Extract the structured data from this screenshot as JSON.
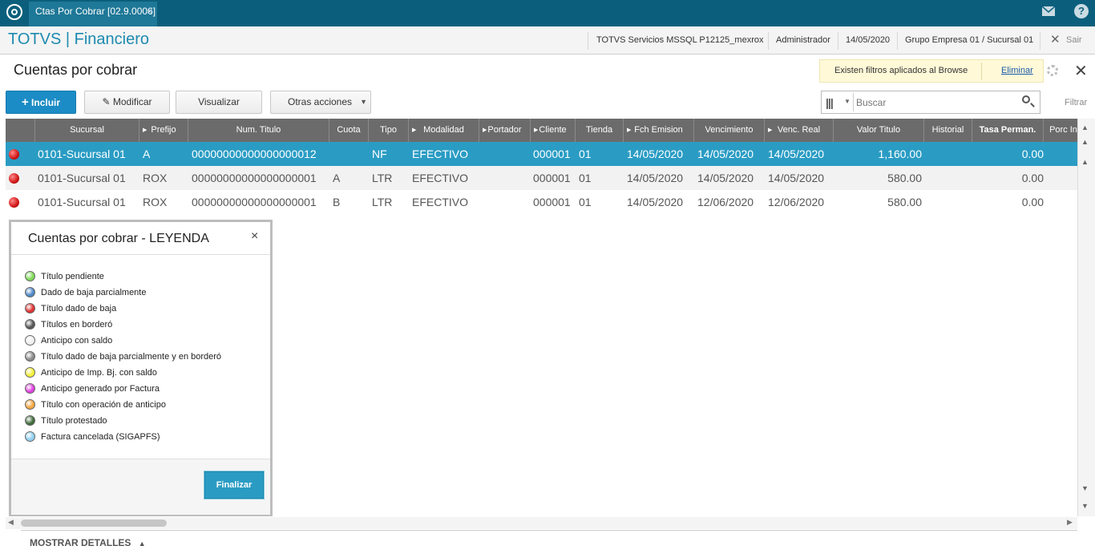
{
  "topbar": {
    "tab_label": "Ctas Por Cobrar [02.9.0006]",
    "tab_close": "×",
    "help_glyph": "?"
  },
  "header": {
    "app_title": "TOTVS | Financiero",
    "server": "TOTVS Servicios MSSQL P12125_mexrox",
    "user": "Administrador",
    "date": "14/05/2020",
    "company": "Grupo Empresa 01 / Sucursal 01",
    "exit_label": "Sair"
  },
  "page": {
    "title": "Cuentas por cobrar",
    "filter_notice": "Existen filtros aplicados al Browse",
    "filter_remove": "Eliminar",
    "close_glyph": "✕"
  },
  "toolbar": {
    "incluir": "Incluir",
    "modificar": "Modificar",
    "visualizar": "Visualizar",
    "otras": "Otras acciones",
    "search_placeholder": "Buscar",
    "filtrar": "Filtrar"
  },
  "grid": {
    "columns": [
      "Sucursal",
      "Prefijo",
      "Num. Titulo",
      "Cuota",
      "Tipo",
      "Modalidad",
      "Portador",
      "Cliente",
      "Tienda",
      "Fch Emision",
      "Vencimiento",
      "Venc. Real",
      "Valor Titulo",
      "Historial",
      "Tasa Perman.",
      "Porc In"
    ],
    "rows": [
      {
        "status": "red",
        "sucursal": "0101-Sucursal 01",
        "prefijo": "A",
        "num": "00000000000000000012",
        "cuota": "",
        "tipo": "NF",
        "modalidad": "EFECTIVO",
        "portador": "",
        "cliente": "000001",
        "tienda": "01",
        "emision": "14/05/2020",
        "vencimiento": "14/05/2020",
        "venc_real": "14/05/2020",
        "valor": "1,160.00",
        "historial": "",
        "tasa": "0.00"
      },
      {
        "status": "red",
        "sucursal": "0101-Sucursal 01",
        "prefijo": "ROX",
        "num": "00000000000000000001",
        "cuota": "A",
        "tipo": "LTR",
        "modalidad": "EFECTIVO",
        "portador": "",
        "cliente": "000001",
        "tienda": "01",
        "emision": "14/05/2020",
        "vencimiento": "14/05/2020",
        "venc_real": "14/05/2020",
        "valor": "580.00",
        "historial": "",
        "tasa": "0.00"
      },
      {
        "status": "red",
        "sucursal": "0101-Sucursal 01",
        "prefijo": "ROX",
        "num": "00000000000000000001",
        "cuota": "B",
        "tipo": "LTR",
        "modalidad": "EFECTIVO",
        "portador": "",
        "cliente": "000001",
        "tienda": "01",
        "emision": "14/05/2020",
        "vencimiento": "12/06/2020",
        "venc_real": "12/06/2020",
        "valor": "580.00",
        "historial": "",
        "tasa": "0.00"
      }
    ]
  },
  "legend": {
    "title": "Cuentas por cobrar - LEYENDA",
    "close_glyph": "×",
    "items": [
      {
        "label": "Título pendiente",
        "color": "#7ed957"
      },
      {
        "label": "Dado de baja parcialmente",
        "color": "#4f86c6"
      },
      {
        "label": "Título dado de baja",
        "color": "#e03030"
      },
      {
        "label": "Títulos en borderó",
        "color": "#555555"
      },
      {
        "label": "Anticipo con saldo",
        "color": "#eeeeee"
      },
      {
        "label": "Título dado de baja parcialmente y en borderó",
        "color": "#8a8a8a"
      },
      {
        "label": "Anticipo de Imp. Bj. con saldo",
        "color": "#f2ef3a"
      },
      {
        "label": "Anticipo generado por Factura",
        "color": "#e040e0"
      },
      {
        "label": "Título con operación de anticipo",
        "color": "#f3a640"
      },
      {
        "label": "Título protestado",
        "color": "#3f6b3a"
      },
      {
        "label": "Factura cancelada (SIGAPFS)",
        "color": "#8fd0f0"
      }
    ],
    "finalizar": "Finalizar"
  },
  "bottom": {
    "mostrar_detalles": "MOSTRAR DETALLES"
  }
}
